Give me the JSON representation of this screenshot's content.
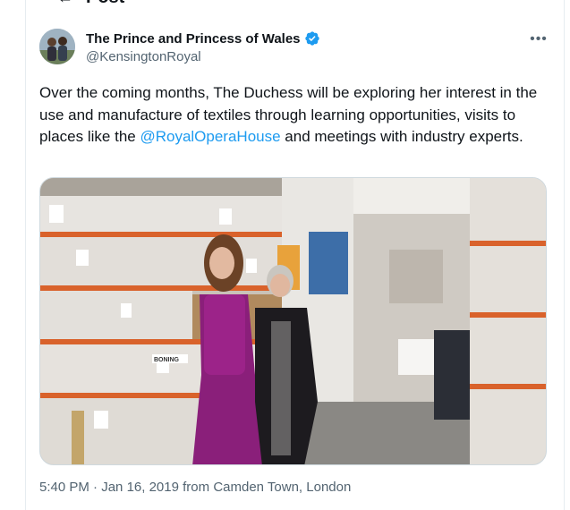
{
  "header": {
    "title": "Post",
    "back_icon": "arrow-left-icon"
  },
  "author": {
    "display_name": "The Prince and Princess of Wales",
    "handle": "@KensingtonRoyal",
    "verified_icon": "verified-badge-icon",
    "verified_color": "#1d9bf0",
    "more_icon": "more-horizontal-icon"
  },
  "tweet": {
    "text_before": "Over the coming months, The Duchess will be exploring her interest in the use and manufacture of textiles through learning opportunities, visits to places like the ",
    "mention": "@RoyalOperaHouse",
    "text_after": " and meetings with industry experts.",
    "link_color": "#1d9bf0"
  },
  "media": {
    "sign_left": "BONING"
  },
  "meta": {
    "time": "5:40 PM",
    "separator": " · ",
    "date": "Jan 16, 2019",
    "from_word": " from ",
    "location": "Camden Town, London"
  }
}
